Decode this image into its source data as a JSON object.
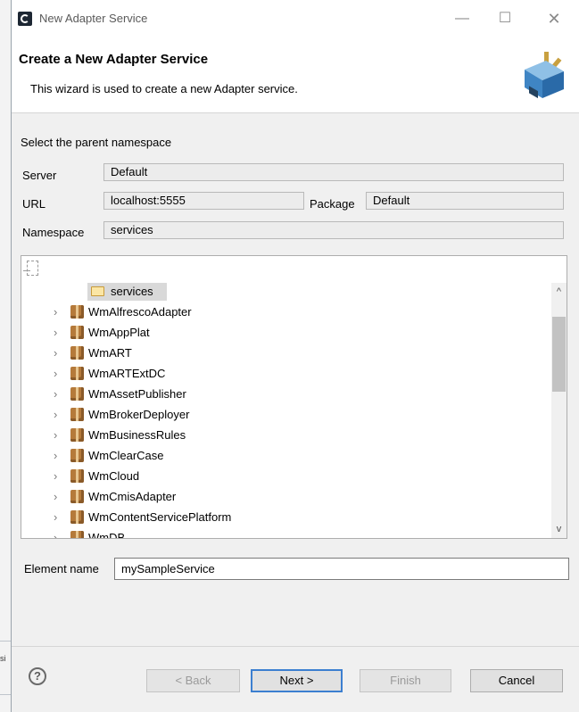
{
  "window": {
    "title": "New Adapter Service",
    "minimize_glyph": "—",
    "maximize_glyph": "☐",
    "close_glyph": "✕"
  },
  "header": {
    "title": "Create a New Adapter Service",
    "description": "This wizard is used to create a new Adapter service.",
    "icon": "adapter-plug-icon"
  },
  "namespace": {
    "section_label": "Select the parent namespace",
    "server_label": "Server",
    "server_value": "Default",
    "url_label": "URL",
    "url_value": "localhost:5555",
    "package_label": "Package",
    "package_value": "Default",
    "namespace_label": "Namespace",
    "namespace_value": "services"
  },
  "tree": {
    "selected": "services",
    "items": [
      "WmAlfrescoAdapter",
      "WmAppPlat",
      "WmART",
      "WmARTExtDC",
      "WmAssetPublisher",
      "WmBrokerDeployer",
      "WmBusinessRules",
      "WmClearCase",
      "WmCloud",
      "WmCmisAdapter",
      "WmContentServicePlatform",
      "WmDB"
    ],
    "expand_glyph": "›",
    "scroll_up_glyph": "^",
    "scroll_down_glyph": "v"
  },
  "element": {
    "label": "Element name",
    "value": "mySampleService"
  },
  "buttons": {
    "help": "?",
    "back": "< Back",
    "next": "Next >",
    "finish": "Finish",
    "cancel": "Cancel"
  },
  "side_fragment": "si"
}
